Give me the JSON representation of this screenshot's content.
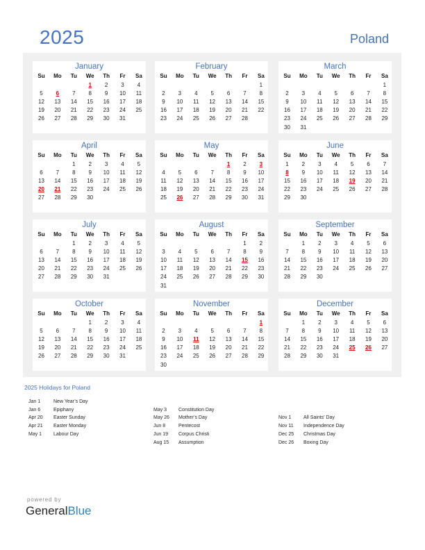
{
  "header": {
    "year": "2025",
    "country": "Poland"
  },
  "weekdays": [
    "Su",
    "Mo",
    "Tu",
    "We",
    "Th",
    "Fr",
    "Sa"
  ],
  "months": [
    {
      "name": "January",
      "start": 3,
      "days": 31,
      "holidays": [
        1,
        6
      ]
    },
    {
      "name": "February",
      "start": 6,
      "days": 28,
      "holidays": []
    },
    {
      "name": "March",
      "start": 6,
      "days": 31,
      "holidays": []
    },
    {
      "name": "April",
      "start": 2,
      "days": 30,
      "holidays": [
        20,
        21
      ]
    },
    {
      "name": "May",
      "start": 4,
      "days": 31,
      "holidays": [
        1,
        3,
        26
      ]
    },
    {
      "name": "June",
      "start": 0,
      "days": 30,
      "holidays": [
        8,
        19
      ]
    },
    {
      "name": "July",
      "start": 2,
      "days": 31,
      "holidays": []
    },
    {
      "name": "August",
      "start": 5,
      "days": 31,
      "holidays": [
        15
      ]
    },
    {
      "name": "September",
      "start": 1,
      "days": 30,
      "holidays": []
    },
    {
      "name": "October",
      "start": 3,
      "days": 31,
      "holidays": []
    },
    {
      "name": "November",
      "start": 6,
      "days": 30,
      "holidays": [
        1,
        11
      ]
    },
    {
      "name": "December",
      "start": 1,
      "days": 31,
      "holidays": [
        25,
        26
      ]
    }
  ],
  "holidays_section": {
    "title": "2025 Holidays for Poland",
    "columns": [
      [
        {
          "date": "Jan 1",
          "name": "New Year’s Day"
        },
        {
          "date": "Jan 6",
          "name": "Epiphany"
        },
        {
          "date": "Apr 20",
          "name": "Easter Sunday"
        },
        {
          "date": "Apr 21",
          "name": "Easter Monday"
        },
        {
          "date": "May 1",
          "name": "Labour Day"
        }
      ],
      [
        {
          "date": "May 3",
          "name": "Constitution Day"
        },
        {
          "date": "May 26",
          "name": "Mother’s Day"
        },
        {
          "date": "Jun 8",
          "name": "Pentecost"
        },
        {
          "date": "Jun 19",
          "name": "Corpus Christi"
        },
        {
          "date": "Aug 15",
          "name": "Assumption"
        }
      ],
      [
        {
          "date": "Nov 1",
          "name": "All Saints’ Day"
        },
        {
          "date": "Nov 11",
          "name": "Independence Day"
        },
        {
          "date": "Dec 25",
          "name": "Christmas Day"
        },
        {
          "date": "Dec 26",
          "name": "Boxing Day"
        }
      ]
    ]
  },
  "footer": {
    "powered_by": "powered by",
    "brand_part1": "General",
    "brand_part2": "Blue"
  },
  "colors": {
    "accent": "#4472C4",
    "holiday": "#E00000",
    "panel": "#F0F0F0",
    "brand_blue": "#2E86C1"
  }
}
